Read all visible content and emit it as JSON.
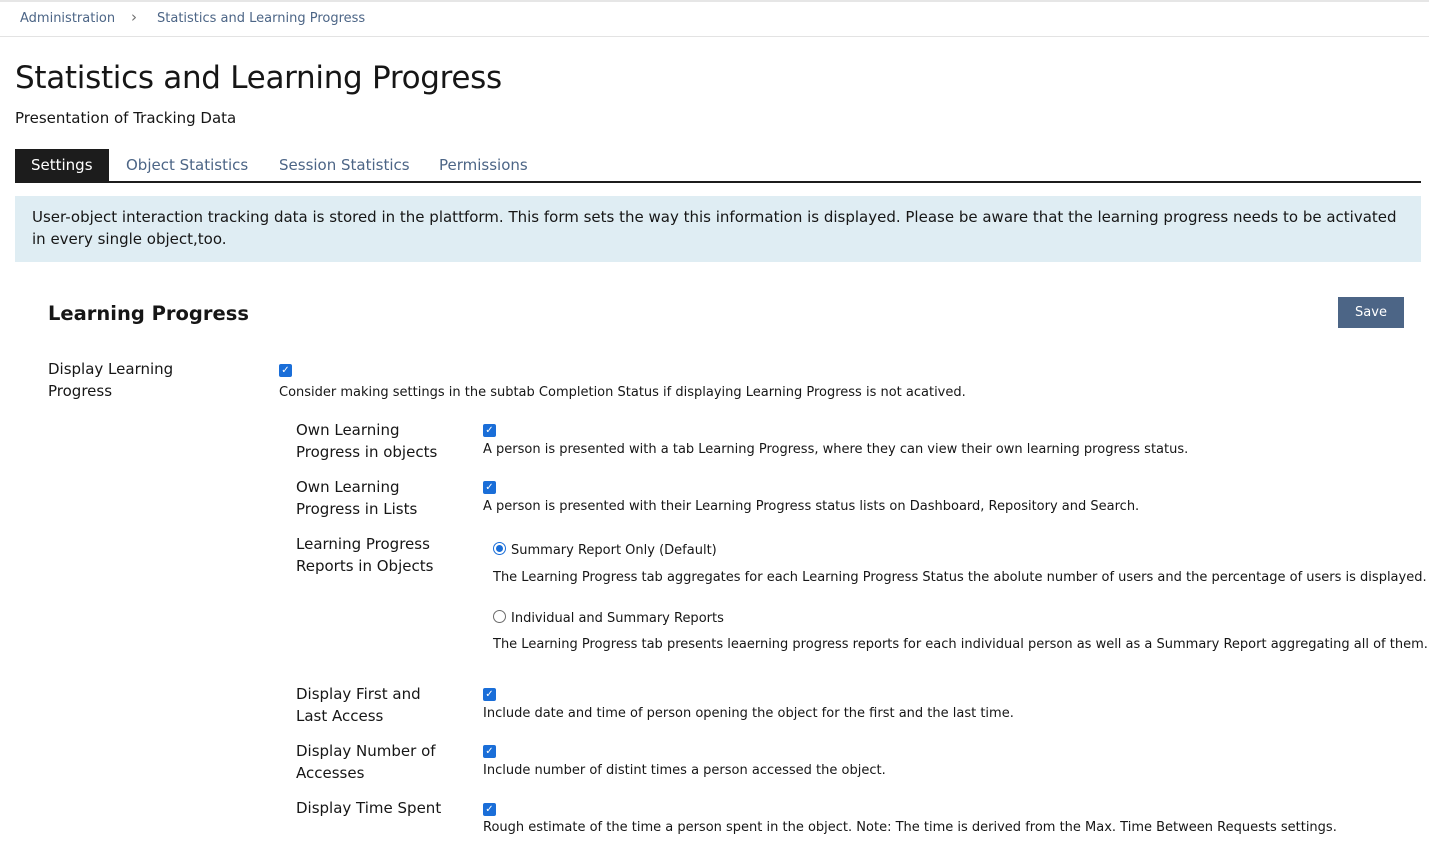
{
  "breadcrumb": {
    "items": [
      "Administration",
      "Statistics and Learning Progress"
    ],
    "separator": "›"
  },
  "header": {
    "title": "Statistics and Learning Progress",
    "subtitle": "Presentation of Tracking Data"
  },
  "tabs": [
    {
      "label": "Settings",
      "active": true
    },
    {
      "label": "Object Statistics",
      "active": false
    },
    {
      "label": "Session Statistics",
      "active": false
    },
    {
      "label": "Permissions",
      "active": false
    }
  ],
  "info_message": "User-object interaction tracking data is stored in the plattform. This form sets the way this information is displayed. Please be aware that the learning progress needs to be activated in every single object,too.",
  "form": {
    "section_title": "Learning Progress",
    "save_label": "Save",
    "display_lp": {
      "label": "Display Learning Progress",
      "checked": true,
      "description": "Consider making settings in the subtab Completion Status if displaying Learning Progress is not acatived."
    },
    "own_lp_objects": {
      "label": "Own Learning Progress in objects",
      "checked": true,
      "description": "A person is presented with a tab Learning Progress, where they can view their own learning progress status."
    },
    "own_lp_lists": {
      "label": "Own Learning Progress in Lists",
      "checked": true,
      "description": "A person is presented with their Learning Progress status lists on Dashboard, Repository and Search."
    },
    "lp_reports": {
      "label": "Learning Progress Reports in Objects",
      "options": [
        {
          "label": "Summary Report Only (Default)",
          "selected": true,
          "description": "The Learning Progress tab aggregates for each Learning Progress Status the abolute number of users and the percentage of users is displayed."
        },
        {
          "label": "Individual and Summary Reports",
          "selected": false,
          "description": "The Learning Progress tab presents leaerning progress reports for each individual person as well as a Summary Report aggregating all of them."
        }
      ]
    },
    "first_last_access": {
      "label": "Display First and Last Access",
      "checked": true,
      "description": "Include date and time of person opening the object for the first and the last time."
    },
    "num_accesses": {
      "label": "Display Number of Accesses",
      "checked": true,
      "description": "Include number of distint times a person accessed the object."
    },
    "time_spent": {
      "label": "Display Time Spent",
      "checked": true,
      "description": "Rough estimate of the time a person spent in the object. Note: The time is derived from the Max. Time Between Requests settings."
    }
  },
  "colors": {
    "accent": "#4c6586",
    "checkbox": "#1a6ed8",
    "info_bg": "#dfedf3",
    "tab_active_bg": "#1c1c1c"
  },
  "icons": {
    "breadcrumb_separator": "chevron-right-icon",
    "checkbox": "check-icon"
  }
}
